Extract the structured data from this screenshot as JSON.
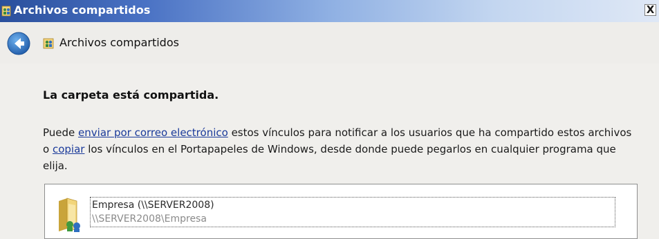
{
  "window": {
    "title": "Archivos compartidos",
    "close_glyph": "X"
  },
  "nav": {
    "title": "Archivos compartidos"
  },
  "main": {
    "heading": "La carpeta está compartida.",
    "text_1": "Puede ",
    "link_email": "enviar por correo electrónico",
    "text_2": " estos vínculos para notificar a los usuarios que ha compartido estos archivos o ",
    "link_copy": "copiar",
    "text_3": " los vínculos en el Portapapeles de Windows, desde donde puede pegarlos en cualquier programa que elija."
  },
  "share": {
    "name": "Empresa (\\\\SERVER2008)",
    "path": "\\\\SERVER2008\\Empresa"
  },
  "icons": {
    "title": "share-people-icon",
    "back": "back-arrow-icon",
    "nav": "share-people-icon",
    "folder": "shared-folder-icon"
  },
  "colors": {
    "title_bar_start": "#2a4f9c",
    "title_bar_end": "#dfe8f6",
    "link": "#1a3a9a",
    "back_button": "#2f78c4"
  }
}
